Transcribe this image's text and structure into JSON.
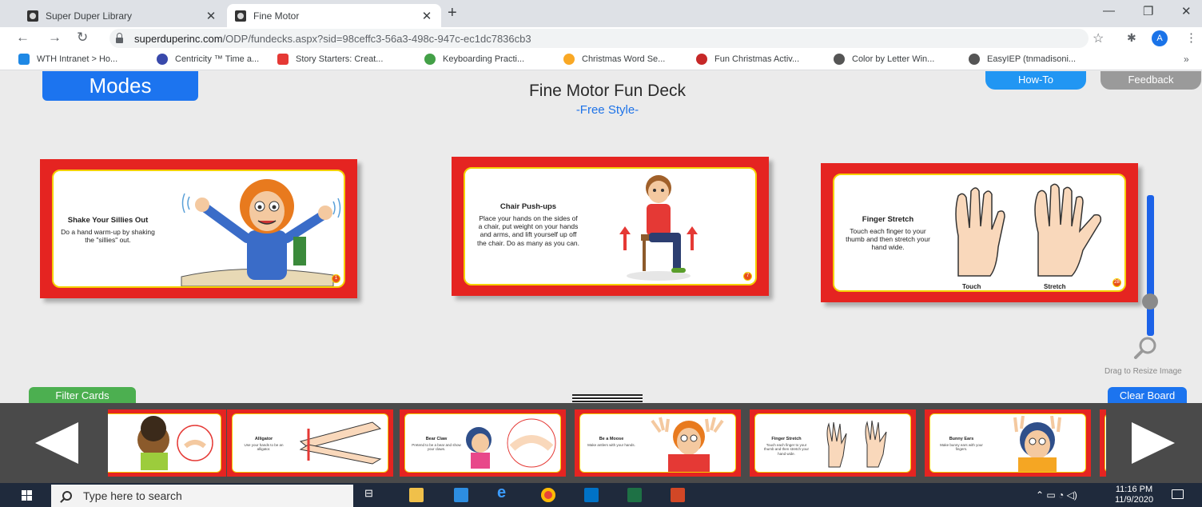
{
  "browser": {
    "tabs": [
      {
        "title": "Super Duper Library",
        "active": false
      },
      {
        "title": "Fine Motor",
        "active": true
      }
    ],
    "url_domain": "superduperinc.com",
    "url_path": "/ODP/fundecks.aspx?sid=98ceffc3-56a3-498c-947c-ec1dc7836cb3",
    "profile_initial": "A",
    "bookmarks": [
      {
        "label": "WTH Intranet > Ho...",
        "color": "#1e88e5"
      },
      {
        "label": "Centricity ™ Time a...",
        "color": "#3949ab"
      },
      {
        "label": "Story Starters: Creat...",
        "color": "#e53935"
      },
      {
        "label": "Keyboarding Practi...",
        "color": "#43a047"
      },
      {
        "label": "Christmas Word Se...",
        "color": "#f9a825"
      },
      {
        "label": "Fun Christmas Activ...",
        "color": "#c62828"
      },
      {
        "label": "Color by Letter Win...",
        "color": "#555555"
      },
      {
        "label": "EasyIEP (tnmadisoni...",
        "color": "#555555"
      }
    ]
  },
  "app": {
    "modes_label": "Modes",
    "title": "Fine Motor Fun Deck",
    "subtitle": "-Free Style-",
    "howto_label": "How-To",
    "feedback_label": "Feedback",
    "drag_label": "Drag to Resize Image",
    "filter_label": "Filter Cards",
    "clear_label": "Clear Board",
    "board_cards": [
      {
        "title": "Shake Your Sillies Out",
        "body": "Do a hand warm-up by shaking the \"sillies\" out.",
        "num": "1"
      },
      {
        "title": "Chair Push-ups",
        "body": "Place your hands on the sides of a chair, put weight on your hands and arms, and lift yourself up off the chair. Do as many as you can.",
        "num": "7"
      },
      {
        "title": "Finger Stretch",
        "body": "Touch each finger to your thumb and then stretch your hand wide.",
        "num": "28",
        "label_left": "Touch",
        "label_right": "Stretch"
      }
    ],
    "tray_cards": [
      {
        "title": "",
        "body": ""
      },
      {
        "title": "Alligator",
        "body": "Use your hands to be an alligator."
      },
      {
        "title": "Bear Claw",
        "body": "Pretend to be a bear and show your claws."
      },
      {
        "title": "Be a Moose",
        "body": "Make antlers with your hands."
      },
      {
        "title": "Finger Stretch",
        "body": "Touch each finger to your thumb and then stretch your hand wide."
      },
      {
        "title": "Bunny Ears",
        "body": "Make bunny ears with your fingers."
      }
    ],
    "colors": {
      "card_red": "#e52421",
      "card_yellow": "#f5d000",
      "accent_blue": "#1c74ef"
    }
  },
  "taskbar": {
    "search_placeholder": "Type here to search",
    "time": "11:16 PM",
    "date": "11/9/2020"
  }
}
